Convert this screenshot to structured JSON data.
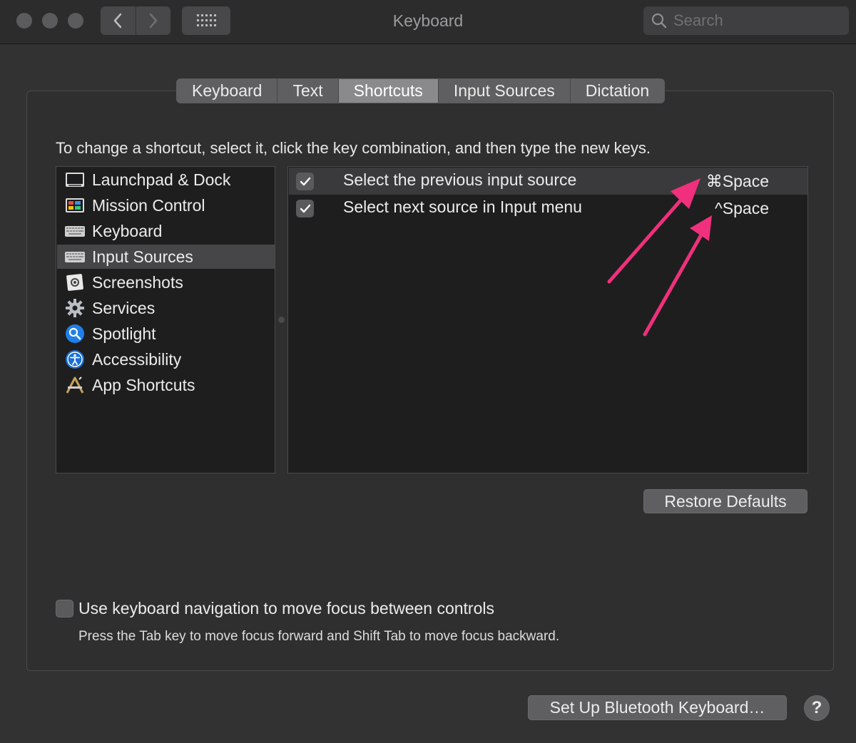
{
  "window": {
    "title": "Keyboard"
  },
  "search": {
    "placeholder": "Search"
  },
  "tabs": [
    {
      "label": "Keyboard",
      "active": false
    },
    {
      "label": "Text",
      "active": false
    },
    {
      "label": "Shortcuts",
      "active": true
    },
    {
      "label": "Input Sources",
      "active": false
    },
    {
      "label": "Dictation",
      "active": false
    }
  ],
  "instruction": "To change a shortcut, select it, click the key combination, and then type the new keys.",
  "categories": [
    {
      "label": "Launchpad & Dock",
      "icon": "launchpad-dock-icon"
    },
    {
      "label": "Mission Control",
      "icon": "mission-control-icon"
    },
    {
      "label": "Keyboard",
      "icon": "keyboard-icon"
    },
    {
      "label": "Input Sources",
      "icon": "keyboard-icon",
      "selected": true
    },
    {
      "label": "Screenshots",
      "icon": "screenshot-icon"
    },
    {
      "label": "Services",
      "icon": "gear-icon"
    },
    {
      "label": "Spotlight",
      "icon": "spotlight-search-icon"
    },
    {
      "label": "Accessibility",
      "icon": "accessibility-icon"
    },
    {
      "label": "App Shortcuts",
      "icon": "app-shortcuts-icon"
    }
  ],
  "shortcuts": [
    {
      "label": "Select the previous input source",
      "key": "⌘Space",
      "checked": true,
      "selected": true
    },
    {
      "label": "Select next source in Input menu",
      "key": "^Space",
      "checked": true,
      "selected": false
    }
  ],
  "buttons": {
    "restore_defaults": "Restore Defaults",
    "bluetooth": "Set Up Bluetooth Keyboard…",
    "help": "?"
  },
  "keyboard_nav": {
    "label": "Use keyboard navigation to move focus between controls",
    "hint": "Press the Tab key to move focus forward and Shift Tab to move focus backward.",
    "checked": false
  },
  "colors": {
    "annotation_arrow": "#f0307c",
    "selected_tab": "#8a8a8d",
    "selected_row": "#464648"
  }
}
